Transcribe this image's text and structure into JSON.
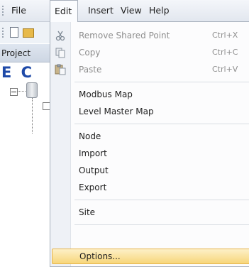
{
  "menubar": {
    "items": [
      "File",
      "Edit",
      "Insert",
      "View",
      "Help"
    ],
    "active": "Edit"
  },
  "panel": {
    "tab_label": "Project",
    "logo_text": "E C"
  },
  "edit_menu": {
    "items": [
      {
        "label": "Remove Shared Point",
        "shortcut": "Ctrl+X",
        "icon": "scissors-icon",
        "enabled": false
      },
      {
        "label": "Copy",
        "shortcut": "Ctrl+C",
        "icon": "copy-icon",
        "enabled": false
      },
      {
        "label": "Paste",
        "shortcut": "Ctrl+V",
        "icon": "paste-icon",
        "enabled": false
      },
      {
        "label": "Modbus Map",
        "enabled": true
      },
      {
        "label": "Level Master Map",
        "enabled": true
      },
      {
        "label": "Node",
        "enabled": true
      },
      {
        "label": "Import",
        "enabled": true
      },
      {
        "label": "Output",
        "enabled": true
      },
      {
        "label": "Export",
        "enabled": true
      },
      {
        "label": "Site",
        "enabled": true
      },
      {
        "label": "Options...",
        "enabled": true,
        "highlighted": true
      }
    ]
  },
  "colors": {
    "highlight_top": "#fdf0c7",
    "highlight_bottom": "#f7d67a",
    "highlight_border": "#e5b44c",
    "disabled_text": "#8e8e8e"
  }
}
